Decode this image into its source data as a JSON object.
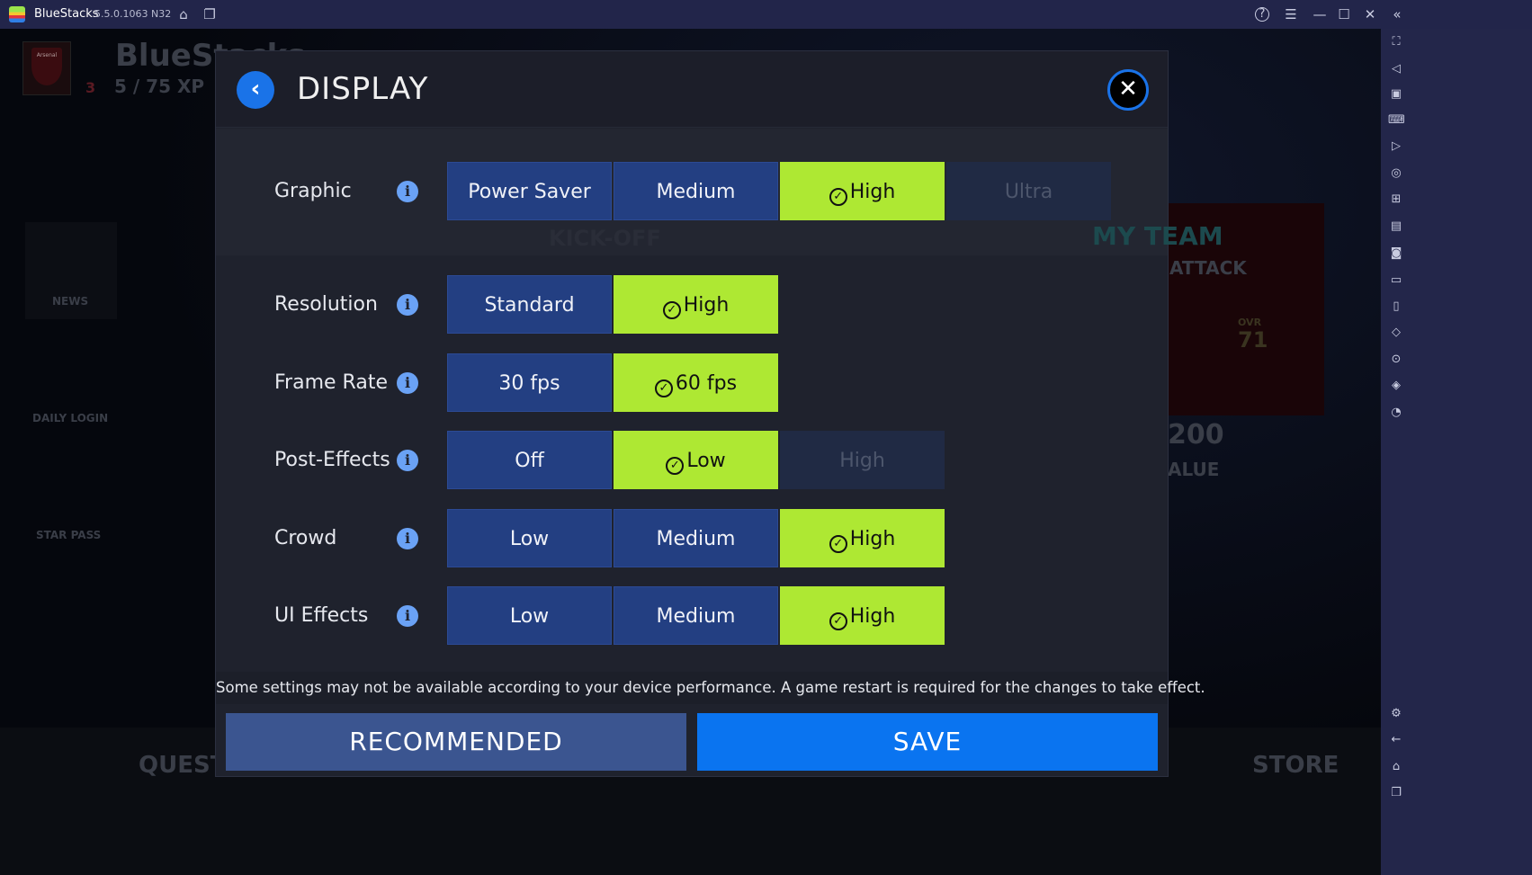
{
  "titlebar": {
    "app_name": "BlueStacks",
    "version": "5.5.0.1063 N32",
    "icons": [
      "home-icon",
      "multi-instance-icon",
      "help-icon",
      "menu-icon",
      "minimize-icon",
      "maximize-icon",
      "close-icon",
      "collapse-sidebar-icon"
    ]
  },
  "background": {
    "player_name": "BlueStacks",
    "level": "3",
    "xp": "5 / 75 XP",
    "club": "Arsenal",
    "left_menu": [
      "NEWS",
      "DAILY LOGIN",
      "STAR PASS"
    ],
    "bottom_nav": [
      "QUESTS",
      "STORE"
    ],
    "tiles": {
      "my_team": "MY TEAM",
      "attack": "ATTACK",
      "ovr_label": "OVR",
      "ovr_value": "71",
      "coins": "200",
      "value": "ALUE",
      "kickoff": "KICK-OFF"
    }
  },
  "sidebar": {
    "icons": [
      "fullscreen-icon",
      "volume-icon",
      "pointer-icon",
      "keyboard-icon",
      "macro-icon",
      "sync-icon",
      "gamepad-icon",
      "apk-icon",
      "screenshot-icon",
      "folder-icon",
      "rotate-icon",
      "shake-icon",
      "location-icon",
      "layers-icon",
      "performance-icon",
      "settings-icon",
      "back-icon",
      "home-icon",
      "recent-apps-icon"
    ]
  },
  "dialog": {
    "title": "DISPLAY",
    "rows": [
      {
        "label": "Graphic",
        "options": [
          {
            "label": "Power Saver",
            "state": "normal"
          },
          {
            "label": "Medium",
            "state": "normal"
          },
          {
            "label": "High",
            "state": "selected"
          },
          {
            "label": "Ultra",
            "state": "disabled"
          }
        ]
      },
      {
        "label": "Resolution",
        "options": [
          {
            "label": "Standard",
            "state": "normal"
          },
          {
            "label": "High",
            "state": "selected"
          }
        ]
      },
      {
        "label": "Frame Rate",
        "options": [
          {
            "label": "30 fps",
            "state": "normal"
          },
          {
            "label": "60 fps",
            "state": "selected"
          }
        ]
      },
      {
        "label": "Post-Effects",
        "options": [
          {
            "label": "Off",
            "state": "normal"
          },
          {
            "label": "Low",
            "state": "selected"
          },
          {
            "label": "High",
            "state": "disabled"
          }
        ]
      },
      {
        "label": "Crowd",
        "options": [
          {
            "label": "Low",
            "state": "normal"
          },
          {
            "label": "Medium",
            "state": "normal"
          },
          {
            "label": "High",
            "state": "selected"
          }
        ]
      },
      {
        "label": "UI Effects",
        "options": [
          {
            "label": "Low",
            "state": "normal"
          },
          {
            "label": "Medium",
            "state": "normal"
          },
          {
            "label": "High",
            "state": "selected"
          }
        ]
      }
    ],
    "note": "Some settings may not be available according to your device performance. A game restart is required for the changes to take effect.",
    "recommended_label": "RECOMMENDED",
    "save_label": "SAVE"
  },
  "colors": {
    "selected": "#aee833",
    "option": "#233f82",
    "save": "#0a74f0",
    "recommended": "#3b5590"
  }
}
